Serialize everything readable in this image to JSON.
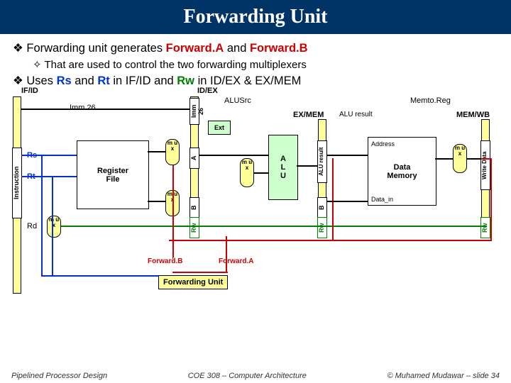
{
  "slide": {
    "title": "Forwarding Unit",
    "bullet1a": "Forwarding unit generates ",
    "bullet1a_hl1": "Forward.A",
    "bullet1a_mid": " and ",
    "bullet1a_hl2": "Forward.B",
    "bullet2a": "That are used to control the two forwarding multiplexers",
    "bullet1b_p1": "Uses ",
    "bullet1b_rs": "Rs",
    "bullet1b_and1": " and ",
    "bullet1b_rt": "Rt",
    "bullet1b_mid": " in IF/ID and ",
    "bullet1b_rw": "Rw",
    "bullet1b_end": " in ID/EX & EX/MEM"
  },
  "labels": {
    "ifid": "IF/ID",
    "idex": "ID/EX",
    "exmem": "EX/MEM",
    "memwb": "MEM/WB",
    "imm26": "Imm 26",
    "imm26v": "Imm 26",
    "instruction": "Instruction",
    "rs": "Rs",
    "rt": "Rt",
    "rd": "Rd",
    "regfile": "Register\nFile",
    "mux": "m\nu\nx",
    "ext": "Ext",
    "a": "A",
    "b": "B",
    "alu": "A\nL\nU",
    "aluresult": "ALU result",
    "aluresult2": "ALU result",
    "alusrc": "ALUSrc",
    "memtoreg": "Memto.Reg",
    "address": "Address",
    "datamem": "Data\nMemory",
    "datain": "Data_in",
    "writedata": "Write Data",
    "rw": "Rw",
    "fwdA": "Forward.A",
    "fwdB": "Forward.B",
    "funit": "Forwarding Unit"
  },
  "footer": {
    "left": "Pipelined Processor Design",
    "center": "COE 308 – Computer Architecture",
    "right": "© Muhamed Mudawar – slide 34"
  }
}
